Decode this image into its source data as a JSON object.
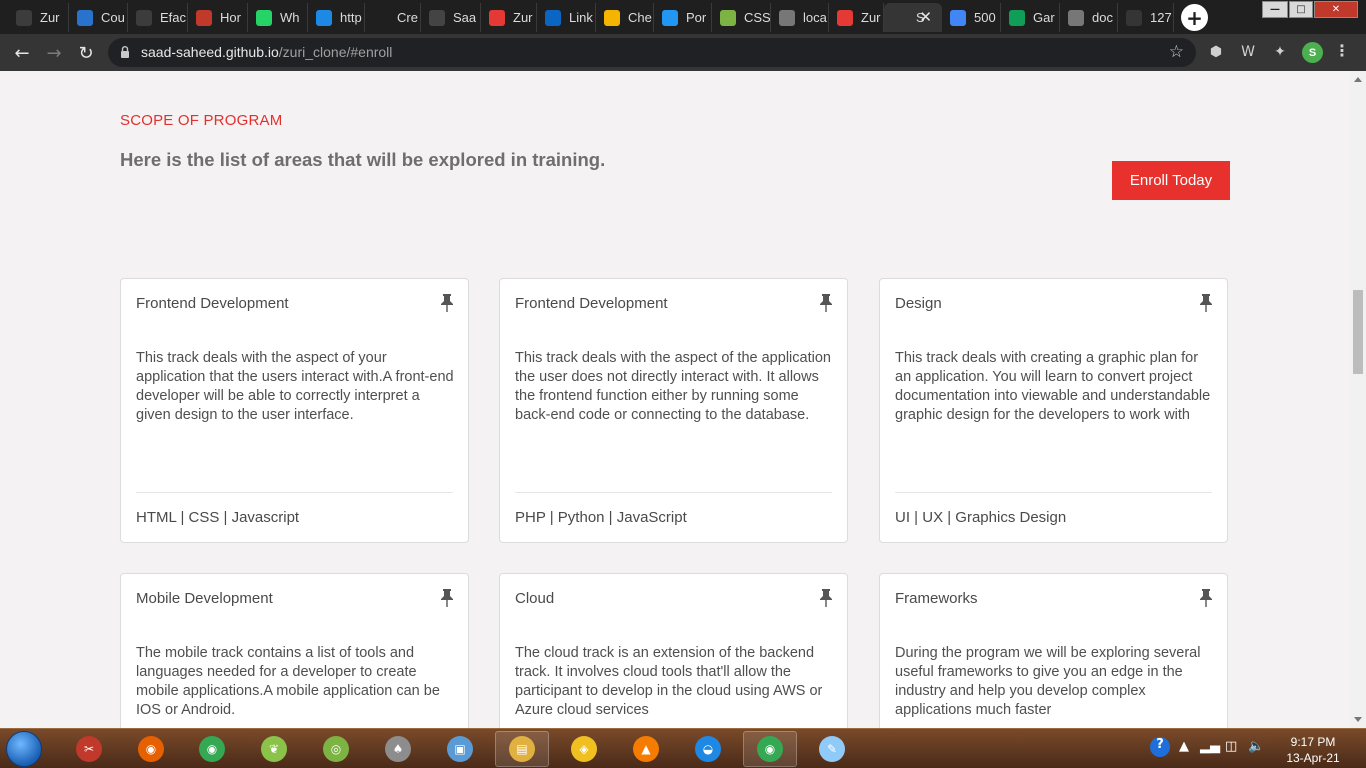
{
  "browser": {
    "tabs": [
      {
        "title": "Zur",
        "icon": "browser-globe-icon",
        "color": "#3c3c3c"
      },
      {
        "title": "Cou",
        "icon": "coursera-icon",
        "color": "#2a73cc"
      },
      {
        "title": "Efac",
        "icon": "browser-globe-icon",
        "color": "#3c3c3c"
      },
      {
        "title": "Hor",
        "icon": "app-icon",
        "color": "#c0392b"
      },
      {
        "title": "Wh",
        "icon": "whatsapp-icon",
        "color": "#25d366"
      },
      {
        "title": "http",
        "icon": "video-icon",
        "color": "#1e88e5"
      },
      {
        "title": "Cre",
        "icon": "blank-icon",
        "color": "#1f1f1f"
      },
      {
        "title": "Saa",
        "icon": "github-icon",
        "color": "#444"
      },
      {
        "title": "Zur",
        "icon": "dot-icon",
        "color": "#e53935"
      },
      {
        "title": "Link",
        "icon": "linkedin-icon",
        "color": "#0a66c2"
      },
      {
        "title": "Che",
        "icon": "gift-icon",
        "color": "#f5b400"
      },
      {
        "title": "Por",
        "icon": "stack-icon",
        "color": "#2196f3"
      },
      {
        "title": "CSS",
        "icon": "chart-icon",
        "color": "#7cb342"
      },
      {
        "title": "loca",
        "icon": "extension-icon",
        "color": "#777"
      },
      {
        "title": "Zur",
        "icon": "dot-icon",
        "color": "#e53935"
      },
      {
        "title": "S",
        "icon": "s-icon",
        "color": "#353535",
        "active": true
      },
      {
        "title": "500",
        "icon": "docs-icon",
        "color": "#4285f4"
      },
      {
        "title": "Gar",
        "icon": "sheets-icon",
        "color": "#0f9d58"
      },
      {
        "title": "doc",
        "icon": "list-icon",
        "color": "#777"
      },
      {
        "title": "127",
        "icon": "s-icon",
        "color": "#353535"
      }
    ],
    "new_tab_label": "+",
    "url_domain": "saad-saheed.github.io",
    "url_path": "/zuri_clone/#enroll",
    "profile_initial": "S"
  },
  "section": {
    "eyebrow": "SCOPE OF PROGRAM",
    "lead": "Here is the list of areas that will be explored in training.",
    "enroll_label": "Enroll Today",
    "accent_color": "#e8312c"
  },
  "cards": [
    {
      "title": "Frontend Development",
      "text": "This track deals with the aspect of your application that the users interact with.A front-end developer will be able to correctly interpret a given design to the user interface.",
      "tags": "HTML | CSS | Javascript"
    },
    {
      "title": "Frontend Development",
      "text": "This track deals with the aspect of the application the user does not directly interact with. It allows the frontend function either by running some back-end code or connecting to the database.",
      "tags": "PHP | Python | JavaScript"
    },
    {
      "title": "Design",
      "text": "This track deals with creating a graphic plan for an application. You will learn to convert project documentation into viewable and understandable graphic design for the developers to work with",
      "tags": "UI | UX | Graphics Design"
    },
    {
      "title": "Mobile Development",
      "text": "The mobile track contains a list of tools and languages needed for a developer to create mobile applications.A mobile application can be IOS or Android.",
      "tags": ""
    },
    {
      "title": "Cloud",
      "text": "The cloud track is an extension of the backend track. It involves cloud tools that'll allow the participant to develop in the cloud using AWS or Azure cloud services",
      "tags": ""
    },
    {
      "title": "Frameworks",
      "text": "During the program we will be exploring several useful frameworks to give you an edge in the industry and help you develop complex applications much faster",
      "tags": ""
    }
  ],
  "taskbar": {
    "apps": [
      {
        "name": "snipping-tool-icon",
        "color": "#c0392b",
        "glyph": "✂"
      },
      {
        "name": "firefox-icon",
        "color": "#e66000",
        "glyph": "◉"
      },
      {
        "name": "chrome-icon",
        "color": "#34a853",
        "glyph": "◉"
      },
      {
        "name": "scanner-icon",
        "color": "#8bc34a",
        "glyph": "❦"
      },
      {
        "name": "cmder-icon",
        "color": "#7cb342",
        "glyph": "◎"
      },
      {
        "name": "feather-icon",
        "color": "#8d8d8d",
        "glyph": "♠"
      },
      {
        "name": "virtualbox-icon",
        "color": "#5b9bd5",
        "glyph": "▣"
      },
      {
        "name": "file-explorer-icon",
        "color": "#e0b040",
        "glyph": "▤"
      },
      {
        "name": "security-icon",
        "color": "#f0c020",
        "glyph": "◈"
      },
      {
        "name": "vlc-icon",
        "color": "#f57c00",
        "glyph": "▲"
      },
      {
        "name": "finder-icon",
        "color": "#1e88e5",
        "glyph": "◒"
      },
      {
        "name": "chrome-open-icon",
        "color": "#34a853",
        "glyph": "◉"
      },
      {
        "name": "paint-icon",
        "color": "#90caf9",
        "glyph": "✎"
      }
    ],
    "time": "9:17 PM",
    "date": "13-Apr-21"
  }
}
